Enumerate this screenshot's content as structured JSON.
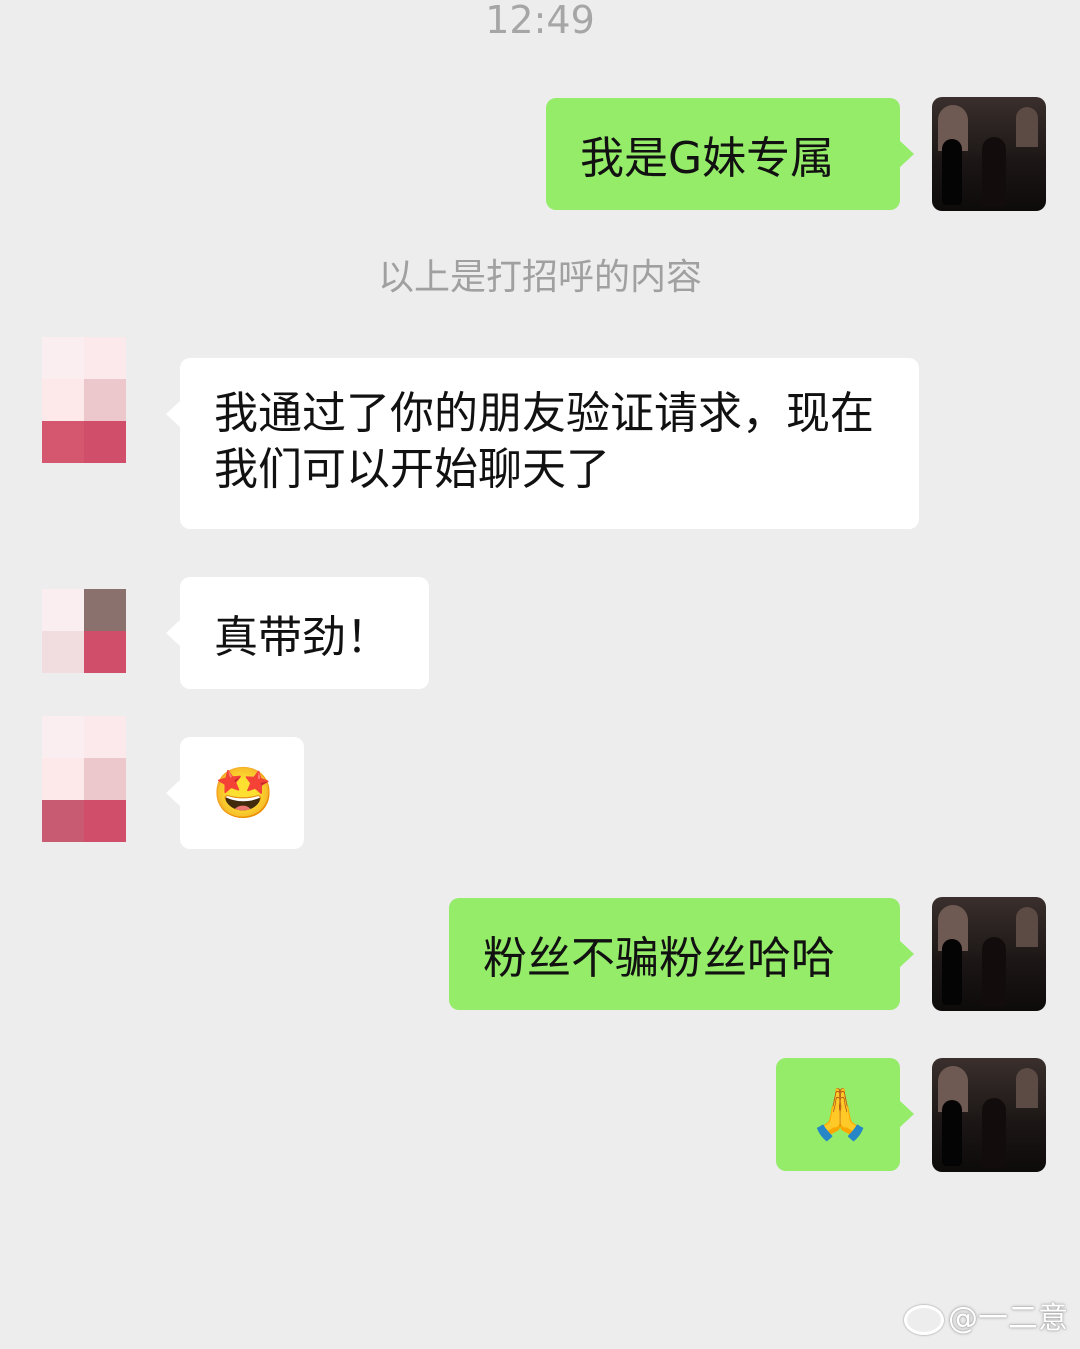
{
  "status_bar": {
    "time": "12:49"
  },
  "system_note": "以上是打招呼的内容",
  "messages": [
    {
      "side": "right",
      "type": "text",
      "text": "我是G妹专属"
    },
    {
      "side": "left",
      "type": "text",
      "text": "我通过了你的朋友验证请求，现在我们可以开始聊天了"
    },
    {
      "side": "left",
      "type": "text",
      "text": "真带劲！"
    },
    {
      "side": "left",
      "type": "emoji",
      "text": "🤩"
    },
    {
      "side": "right",
      "type": "text",
      "text": "粉丝不骗粉丝哈哈"
    },
    {
      "side": "right",
      "type": "emoji",
      "text": "🙏"
    }
  ],
  "watermark": "@一二意",
  "colors": {
    "background": "#ededed",
    "self_bubble": "#95ec69",
    "other_bubble": "#ffffff",
    "timestamp_text": "#a6a6a6"
  }
}
